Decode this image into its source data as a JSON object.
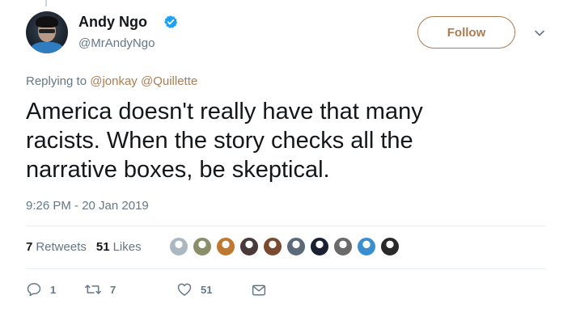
{
  "author": {
    "name": "Andy Ngo",
    "handle": "@MrAndyNgo",
    "verified": true
  },
  "follow_button": {
    "label": "Follow"
  },
  "reply_context": {
    "prefix": "Replying to",
    "mentions": [
      "@jonkay",
      "@Quillette"
    ]
  },
  "tweet": {
    "lines": [
      "America doesn't really have that many",
      "racists. When the story checks all the",
      "narrative boxes, be skeptical."
    ],
    "timestamp": "9:26 PM - 20 Jan 2019"
  },
  "stats": {
    "retweets_count": "7",
    "retweets_label": "Retweets",
    "likes_count": "51",
    "likes_label": "Likes"
  },
  "actions": {
    "reply_count": "1",
    "retweet_count": "7",
    "like_count": "51"
  },
  "likers": [
    {
      "name": "default-avatar",
      "color": "#aab8c2"
    },
    {
      "name": "liker-avatar-2",
      "color": "#8a8f6a"
    },
    {
      "name": "liker-avatar-3",
      "color": "#c0782e"
    },
    {
      "name": "liker-avatar-4",
      "color": "#4a3a3a"
    },
    {
      "name": "liker-avatar-5",
      "color": "#7a4a30"
    },
    {
      "name": "liker-avatar-6",
      "color": "#5a6a7a"
    },
    {
      "name": "liker-avatar-7",
      "color": "#1a2030"
    },
    {
      "name": "liker-avatar-8",
      "color": "#6a6a6a"
    },
    {
      "name": "liker-avatar-9",
      "color": "#3a8fd0"
    },
    {
      "name": "liker-avatar-10",
      "color": "#2a2a2a"
    }
  ],
  "colors": {
    "accent": "#ab7c53",
    "verified_blue": "#1da1f2",
    "muted": "#657786",
    "text": "#14171a"
  }
}
